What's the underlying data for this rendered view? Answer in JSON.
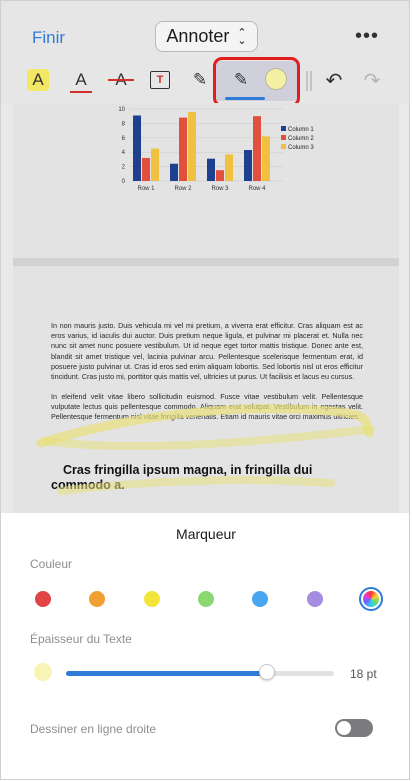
{
  "header": {
    "done_label": "Finir",
    "mode_label": "Annoter",
    "more_label": "•••"
  },
  "toolbar": {
    "highlight_glyph": "A",
    "underline_glyph": "A",
    "strike_glyph": "A",
    "textbox_glyph": "T",
    "pen_glyph": "✎",
    "marker_glyph": "✎",
    "undo_glyph": "↶",
    "redo_glyph": "↷",
    "selected_color": "#f3f0a4"
  },
  "document": {
    "chart_data": {
      "type": "bar",
      "categories": [
        "Row 1",
        "Row 2",
        "Row 3",
        "Row 4"
      ],
      "series": [
        {
          "name": "Column 1",
          "values": [
            9.1,
            2.4,
            3.1,
            4.3
          ],
          "color": "#1f3f8f"
        },
        {
          "name": "Column 2",
          "values": [
            3.2,
            8.8,
            1.5,
            9.0
          ],
          "color": "#e0503a"
        },
        {
          "name": "Column 3",
          "values": [
            4.5,
            9.6,
            3.7,
            6.2
          ],
          "color": "#f0c040"
        }
      ],
      "ylim": [
        0,
        10
      ],
      "yticks": [
        "0",
        "2",
        "4",
        "6",
        "8",
        "10"
      ],
      "legend": "right"
    },
    "para1": "In non mauris justo. Duis vehicula mi vel mi pretium, a viverra erat efficitur. Cras aliquam est ac eros varius, id iaculis dui auctor. Duis pretium neque ligula, et pulvinar mi placerat et. Nulla nec nunc sit amet nunc posuere vestibulum. Ut id neque eget tortor mattis tristique. Donec ante est, blandit sit amet tristique vel, lacinia pulvinar arcu. Pellentesque scelerisque fermentum erat, id posuere justo pulvinar ut. Cras id eros sed enim aliquam lobortis. Sed lobortis nisl ut eros efficitur tincidunt. Cras justo mi, porttitor quis mattis vel, ultricies ut purus. Ut facilisis et lacus eu cursus.",
    "para2": "In eleifend velit vitae libero sollicitudin euismod. Fusce vitae vestibulum velit. Pellentesque vulputate lectus quis pellentesque commodo. Aliquam erat volutpat. Vestibulum in egestas velit. Pellentesque fermentum nisl vitae fringilla venenatis. Etiam id mauris vitae orci maximus ultricies.",
    "heading": "Cras fringilla ipsum magna, in fringilla dui commodo a."
  },
  "sheet": {
    "title": "Marqueur",
    "color_label": "Couleur",
    "colors": [
      "#e04444",
      "#f0a030",
      "#f2e43a",
      "#8ad870",
      "#48a6f0",
      "#a58ce0"
    ],
    "thickness_label": "Épaisseur du Texte",
    "thickness_fraction": 0.75,
    "thickness_value": "18 pt",
    "straight_line_label": "Dessiner en ligne droite",
    "straight_line_on": false
  }
}
